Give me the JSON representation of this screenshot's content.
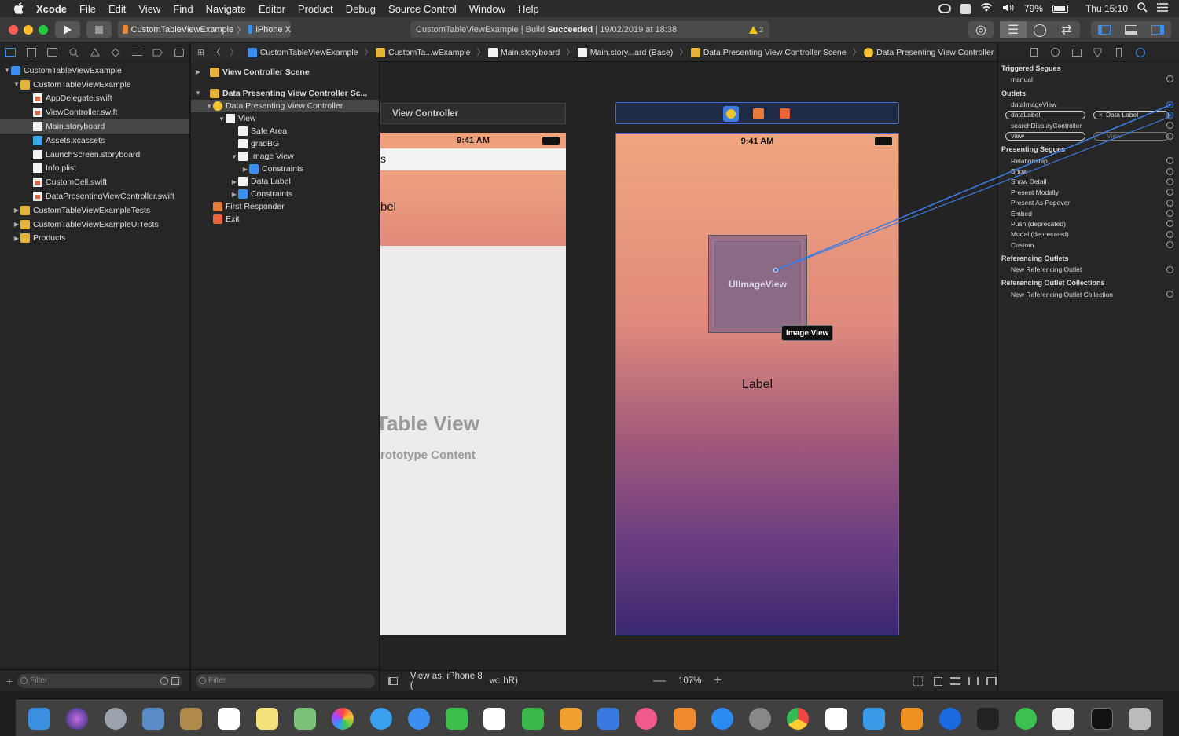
{
  "menubar": {
    "app": "Xcode",
    "items": [
      "File",
      "Edit",
      "View",
      "Find",
      "Navigate",
      "Editor",
      "Product",
      "Debug",
      "Source Control",
      "Window",
      "Help"
    ],
    "battery": "79%",
    "clock": "Thu 15:10"
  },
  "toolbar": {
    "scheme": "CustomTableViewExample",
    "device": "iPhone X",
    "status_prefix": "CustomTableViewExample | Build",
    "status_result": "Succeeded",
    "status_date": "| 19/02/2019 at 18:38",
    "warning_count": "2"
  },
  "navigator": {
    "items": [
      {
        "label": "CustomTableViewExample",
        "icon": "proj",
        "indent": 0,
        "tri": "▼"
      },
      {
        "label": "CustomTableViewExample",
        "icon": "folder",
        "indent": 1,
        "tri": "▼"
      },
      {
        "label": "AppDelegate.swift",
        "icon": "swift",
        "indent": 2,
        "tri": ""
      },
      {
        "label": "ViewController.swift",
        "icon": "swift",
        "indent": 2,
        "tri": ""
      },
      {
        "label": "Main.storyboard",
        "icon": "file",
        "indent": 2,
        "tri": "",
        "selected": true
      },
      {
        "label": "Assets.xcassets",
        "icon": "xc",
        "indent": 2,
        "tri": ""
      },
      {
        "label": "LaunchScreen.storyboard",
        "icon": "file",
        "indent": 2,
        "tri": ""
      },
      {
        "label": "Info.plist",
        "icon": "file",
        "indent": 2,
        "tri": ""
      },
      {
        "label": "CustomCell.swift",
        "icon": "swift",
        "indent": 2,
        "tri": ""
      },
      {
        "label": "DataPresentingViewController.swift",
        "icon": "swift",
        "indent": 2,
        "tri": ""
      },
      {
        "label": "CustomTableViewExampleTests",
        "icon": "folder",
        "indent": 1,
        "tri": "▶"
      },
      {
        "label": "CustomTableViewExampleUITests",
        "icon": "folder",
        "indent": 1,
        "tri": "▶"
      },
      {
        "label": "Products",
        "icon": "folder",
        "indent": 1,
        "tri": "▶"
      }
    ],
    "filter_placeholder": "Filter"
  },
  "jumpbar": [
    "CustomTableViewExample",
    "CustomTa...wExample",
    "Main.storyboard",
    "Main.story...ard (Base)",
    "Data Presenting View Controller Scene",
    "Data Presenting View Controller"
  ],
  "outline": {
    "scene1": "View Controller Scene",
    "scene2": "Data Presenting View Controller Sc...",
    "items": [
      {
        "label": "Data Presenting View Controller",
        "icon": "folder",
        "indent": 1,
        "tri": "▼",
        "selected": true
      },
      {
        "label": "View",
        "icon": "file",
        "indent": 2,
        "tri": "▼"
      },
      {
        "label": "Safe Area",
        "icon": "file",
        "indent": 3,
        "tri": ""
      },
      {
        "label": "gradBG",
        "icon": "file",
        "indent": 3,
        "tri": ""
      },
      {
        "label": "Image View",
        "icon": "file",
        "indent": 3,
        "tri": "▼"
      },
      {
        "label": "Constraints",
        "icon": "proj",
        "indent": 4,
        "tri": "▶"
      },
      {
        "label": "Data Label",
        "icon": "file",
        "indent": 3,
        "tri": "▶"
      },
      {
        "label": "Constraints",
        "icon": "proj",
        "indent": 3,
        "tri": "▶"
      },
      {
        "label": "First Responder",
        "icon": "folder",
        "indent": 1,
        "tri": ""
      },
      {
        "label": "Exit",
        "icon": "folder",
        "indent": 1,
        "tri": ""
      }
    ],
    "filter_placeholder": "Filter"
  },
  "canvas": {
    "vc_title": "View Controller",
    "time": "9:41 AM",
    "vc_cell_head": "s",
    "vc_cell_label": "bel",
    "vc_table": "Table View",
    "vc_proto": "rototype Content",
    "dp_time": "9:41 AM",
    "imageview": "UIImageView",
    "tooltip": "Image View",
    "label": "Label",
    "view_as": "View as: iPhone 8 (",
    "view_as_mid": "wC",
    "view_as_end": "hR)",
    "zoom": "107%"
  },
  "inspector": {
    "triggered": "Triggered Segues",
    "manual": "manual",
    "outlets": "Outlets",
    "outlet_items": [
      "dataImageView",
      "dataLabel",
      "searchDisplayController",
      "view"
    ],
    "outlet_target": "Data Label",
    "view_target": "View",
    "presenting": "Presenting Segues",
    "segues": [
      "Relationship",
      "Show",
      "Show Detail",
      "Present Modally",
      "Present As Popover",
      "Embed",
      "Push (deprecated)",
      "Modal (deprecated)",
      "Custom"
    ],
    "ref_outlets": "Referencing Outlets",
    "new_ref": "New Referencing Outlet",
    "ref_collections": "Referencing Outlet Collections",
    "new_ref_coll": "New Referencing Outlet Collection"
  },
  "colors": {
    "accent": "#3d7be0",
    "folder": "#e5b23a",
    "warning": "#f1c40f"
  }
}
